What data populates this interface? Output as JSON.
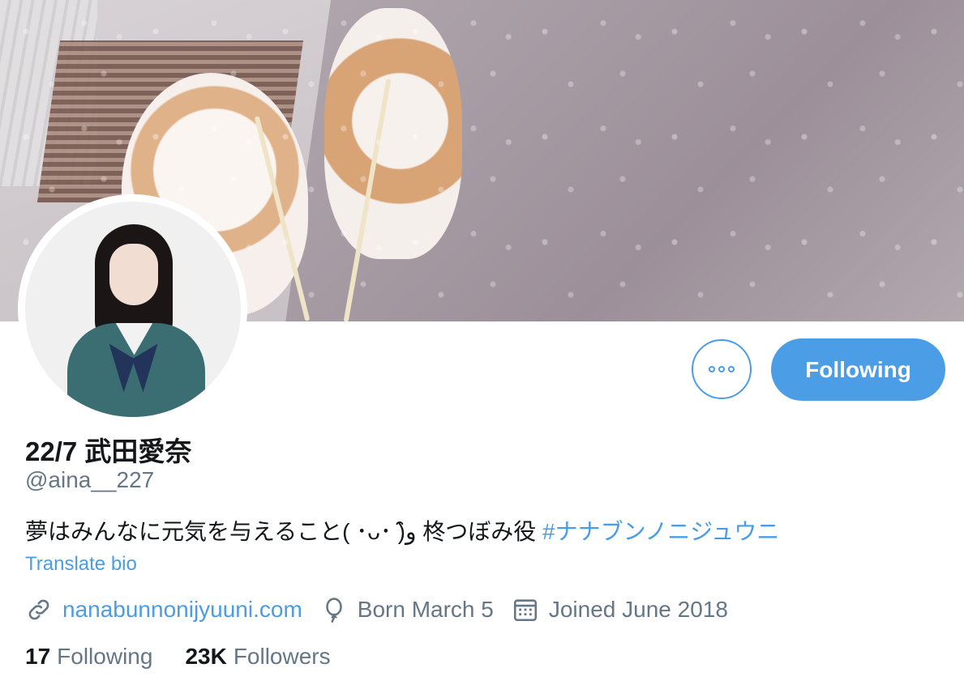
{
  "profile": {
    "name": "22/7 武田愛奈",
    "handle": "@aina__227",
    "bio_text": "夢はみんなに元気を与えること( ･ᴗ･ )و̑̑ 柊つぼみ役",
    "bio_hashtag": "#ナナブンノニジュウニ",
    "translate_label": "Translate bio"
  },
  "actions": {
    "more_icon": "more-horizontal-icon",
    "follow_label": "Following"
  },
  "meta": {
    "website": "nanabunnonijyuuni.com",
    "birthday": "Born March 5",
    "joined": "Joined June 2018",
    "icons": [
      "link-icon",
      "balloon-icon",
      "calendar-icon"
    ]
  },
  "stats": {
    "following_count": "17",
    "following_label": "Following",
    "followers_count": "23K",
    "followers_label": "Followers"
  },
  "colors": {
    "accent": "#4b9ee6",
    "secondary_text": "#657786",
    "primary_text": "#14171a"
  }
}
